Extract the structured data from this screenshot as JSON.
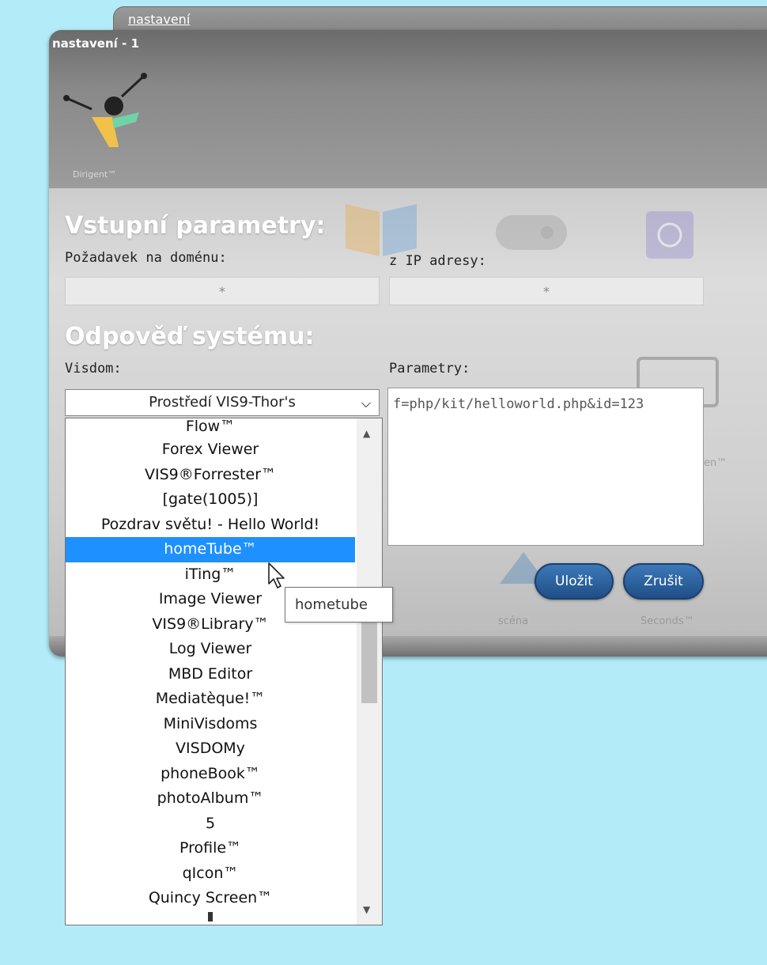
{
  "background_tab": {
    "title": "nastavení"
  },
  "window": {
    "title": "nastavení - 1",
    "logo_caption": "Dirigent™"
  },
  "input_section": {
    "heading": "Vstupní parametry:",
    "domain_label": "Požadavek na doménu:",
    "domain_value": "*",
    "ip_label": "z IP adresy:",
    "ip_value": "*"
  },
  "response_section": {
    "heading": "Odpověď systému:",
    "visdom_label": "Visdom:",
    "visdom_selected": "Prostředí VIS9-Thor's",
    "parameters_label": "Parametry:",
    "parameters_value": "f=php/kit/helloworld.php&id=123"
  },
  "buttons": {
    "save": "Uložit",
    "cancel": "Zrušit"
  },
  "background_labels": [
    "scéna",
    "Seconds™",
    "een™"
  ],
  "dropdown": {
    "items": [
      "Flow™",
      "Forex Viewer",
      "VIS9®Forrester™",
      "[gate(1005)]",
      "Pozdrav světu! - Hello World!",
      "homeTube™",
      "iTing™",
      "Image Viewer",
      "VIS9®Library™",
      "Log Viewer",
      "MBD Editor",
      "Mediatèque!™",
      "MiniVisdoms",
      "VISDOMy",
      "phoneBook™",
      "photoAlbum™",
      "5",
      "Profile™",
      "qIcon™",
      "Quincy Screen™"
    ],
    "highlighted": "homeTube™"
  },
  "tooltip": "hometube",
  "colors": {
    "page_bg": "#b3ecf8",
    "highlight": "#1e90ff",
    "button": "#2a5f9e"
  }
}
